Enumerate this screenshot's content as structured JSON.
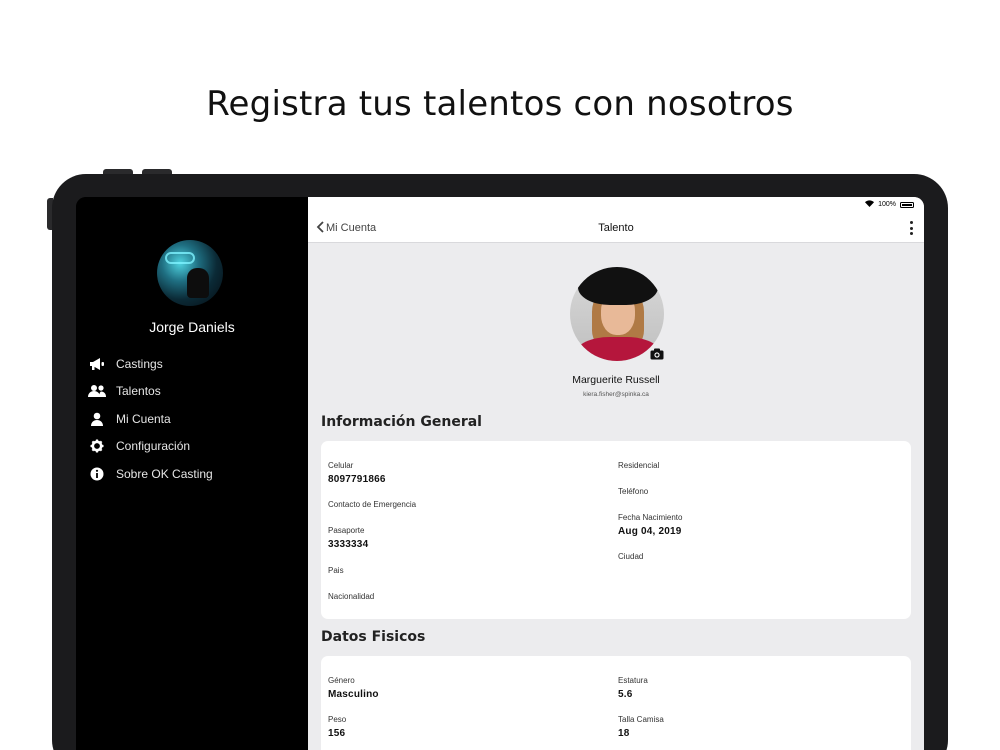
{
  "headline": "Registra tus talentos con nosotros",
  "sidebar": {
    "user_name": "Jorge Daniels",
    "items": [
      {
        "label": "Castings",
        "icon": "megaphone-icon"
      },
      {
        "label": "Talentos",
        "icon": "users-icon"
      },
      {
        "label": "Mi Cuenta",
        "icon": "user-icon"
      },
      {
        "label": "Configuración",
        "icon": "gear-icon"
      },
      {
        "label": "Sobre OK Casting",
        "icon": "info-icon"
      }
    ]
  },
  "status": {
    "battery": "100%"
  },
  "nav": {
    "back_label": "Mi Cuenta",
    "title": "Talento"
  },
  "profile": {
    "name": "Marguerite Russell",
    "email": "kiera.fisher@spinka.ca"
  },
  "general": {
    "title": "Información General",
    "celular_label": "Celular",
    "celular_value": "8097791866",
    "contacto_label": "Contacto de Emergencia",
    "pasaporte_label": "Pasaporte",
    "pasaporte_value": "3333334",
    "pais_label": "Pais",
    "nacionalidad_label": "Nacionalidad",
    "residencial_label": "Residencial",
    "telefono_label": "Teléfono",
    "nacimiento_label": "Fecha Nacimiento",
    "nacimiento_value": "Aug 04, 2019",
    "ciudad_label": "Ciudad"
  },
  "fisicos": {
    "title": "Datos Fisicos",
    "genero_label": "Género",
    "genero_value": "Masculino",
    "estatura_label": "Estatura",
    "estatura_value": "5.6",
    "peso_label": "Peso",
    "peso_value": "156",
    "camisa_label": "Talla Camisa",
    "camisa_value": "18"
  },
  "colors": {
    "sidebar_bg": "#000000",
    "content_bg": "#ececee",
    "card_bg": "#ffffff",
    "accent_shirt": "#b5163c"
  }
}
